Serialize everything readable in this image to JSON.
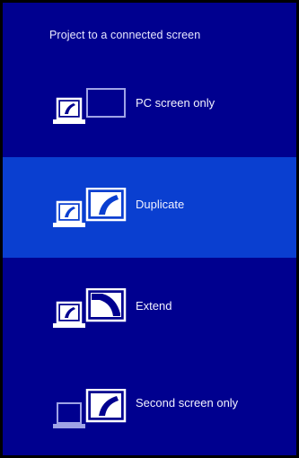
{
  "title": "Project to a connected screen",
  "colors": {
    "background": "#00008f",
    "selected": "#0a3fd0",
    "text": "#f2f2ff",
    "border": "#000000"
  },
  "options": [
    {
      "label": "PC screen only",
      "icon": "pc-screen-only-icon",
      "selected": false
    },
    {
      "label": "Duplicate",
      "icon": "duplicate-icon",
      "selected": true
    },
    {
      "label": "Extend",
      "icon": "extend-icon",
      "selected": false
    },
    {
      "label": "Second screen only",
      "icon": "second-screen-only-icon",
      "selected": false
    }
  ]
}
